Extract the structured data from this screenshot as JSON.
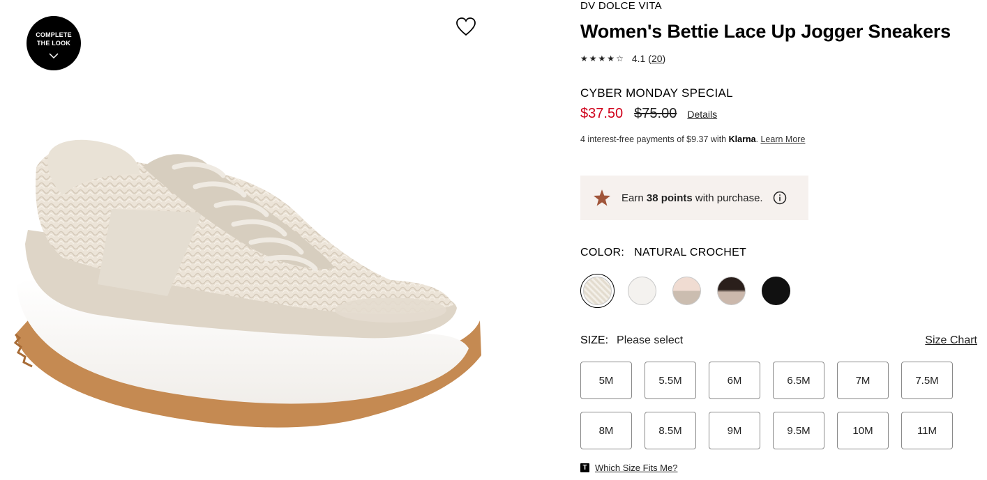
{
  "complete_look": {
    "line1": "COMPLETE",
    "line2": "THE LOOK"
  },
  "product": {
    "brand": "DV DOLCE VITA",
    "title": "Women's Bettie Lace Up Jogger Sneakers",
    "rating": {
      "value": "4.1",
      "count_open": "(",
      "count": "20",
      "count_close": ")",
      "stars": 4.1,
      "stars_max": 5
    }
  },
  "pricing": {
    "promo_label": "CYBER MONDAY SPECIAL",
    "sale_price": "$37.50",
    "original_price": "$75.00",
    "details_label": "Details",
    "sale_color": "#d0021b"
  },
  "klarna": {
    "prefix": "4 interest-free payments of $9.37 with ",
    "brand": "Klarna",
    "suffix": ". ",
    "learn_more": "Learn More"
  },
  "points": {
    "earn": "Earn ",
    "amount": "38 points",
    "suffix": " with purchase.",
    "star_color": "#a0553a",
    "box_color": "#f6f1ee"
  },
  "color": {
    "label": "COLOR:",
    "selected": "NATURAL CROCHET",
    "swatches": [
      {
        "name": "natural-crochet",
        "colors": [
          "#ebe6de",
          "#ebe6de"
        ],
        "selected": true
      },
      {
        "name": "white",
        "colors": [
          "#f4f2ef",
          "#f4f2ef"
        ],
        "selected": false
      },
      {
        "name": "blush",
        "colors": [
          "#f0dcd2",
          "#cbbdb0"
        ],
        "selected": false
      },
      {
        "name": "black-taupe",
        "colors": [
          "#2a1f1b",
          "#cbb8ac"
        ],
        "selected": false
      },
      {
        "name": "black",
        "colors": [
          "#111111",
          "#111111"
        ],
        "selected": false
      }
    ]
  },
  "size": {
    "label": "SIZE:",
    "selected": "Please select",
    "chart_label": "Size Chart",
    "options": [
      "5M",
      "5.5M",
      "6M",
      "6.5M",
      "7M",
      "7.5M",
      "8M",
      "8.5M",
      "9M",
      "9.5M",
      "10M",
      "11M"
    ]
  },
  "fit": {
    "badge": "T",
    "label": "Which Size Fits Me?"
  }
}
